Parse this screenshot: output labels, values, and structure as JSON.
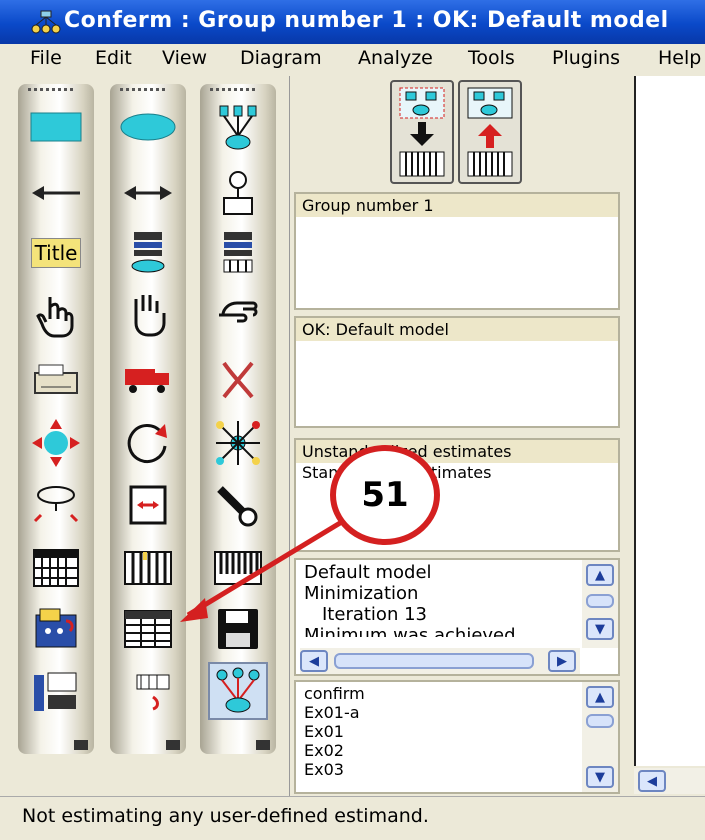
{
  "window": {
    "title": "Conferm : Group number 1 : OK: Default model"
  },
  "menu": {
    "file": "File",
    "edit": "Edit",
    "view": "View",
    "diagram": "Diagram",
    "analyze": "Analyze",
    "tools": "Tools",
    "plugins": "Plugins",
    "help": "Help"
  },
  "toolbox": {
    "title_tool_label": "Title"
  },
  "panel": {
    "groups_header": "Group number 1",
    "models_header": "OK: Default model",
    "estimates": [
      "Unstandardized estimates",
      "Standardized estimates"
    ],
    "output_lines": [
      "Default model",
      "Minimization",
      "Iteration 13",
      "Minimum was achieved"
    ],
    "files": [
      "confirm",
      "Ex01-a",
      "Ex01",
      "Ex02",
      "Ex03"
    ]
  },
  "callout": {
    "number": "51"
  },
  "status": {
    "text": "Not estimating any user-defined estimand."
  },
  "colors": {
    "title_bar": "#0a49c9",
    "callout_red": "#d42020",
    "tool_cyan": "#2ec9d9"
  }
}
